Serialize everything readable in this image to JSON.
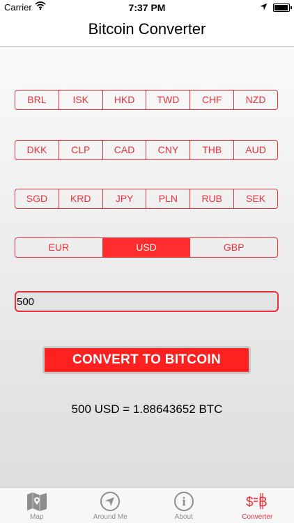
{
  "status_bar": {
    "carrier": "Carrier",
    "time": "7:37 PM"
  },
  "nav": {
    "title": "Bitcoin Converter"
  },
  "currency_rows": [
    [
      "BRL",
      "ISK",
      "HKD",
      "TWD",
      "CHF",
      "NZD"
    ],
    [
      "DKK",
      "CLP",
      "CAD",
      "CNY",
      "THB",
      "AUD"
    ],
    [
      "SGD",
      "KRD",
      "JPY",
      "PLN",
      "RUB",
      "SEK"
    ]
  ],
  "main_currencies": {
    "items": [
      "EUR",
      "USD",
      "GBP"
    ],
    "selected": "USD"
  },
  "amount": {
    "value": "500"
  },
  "convert_button": {
    "label": "CONVERT TO BITCOIN"
  },
  "result": {
    "text": "500 USD = 1.88643652 BTC"
  },
  "tabs": [
    {
      "label": "Map",
      "icon": "map-icon"
    },
    {
      "label": "Around Me",
      "icon": "navigation-arrow-icon"
    },
    {
      "label": "About",
      "icon": "info-icon"
    },
    {
      "label": "Converter",
      "icon": "dollar-bitcoin-icon",
      "active": true
    }
  ],
  "colors": {
    "accent": "#e8313a",
    "selected_fill": "#ff2d2d"
  }
}
